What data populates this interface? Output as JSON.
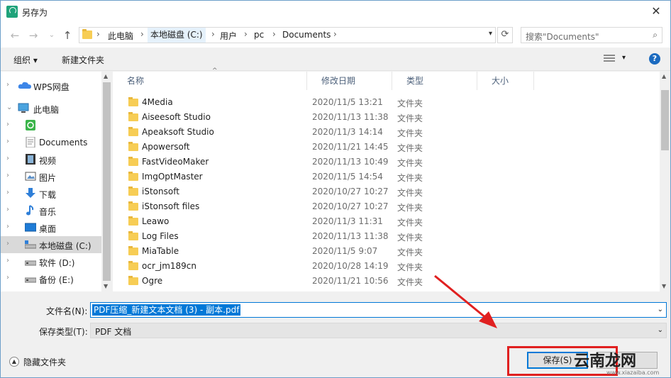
{
  "window": {
    "title": "另存为",
    "close_glyph": "✕",
    "app_icon_label": "PDF"
  },
  "address": {
    "crumbs": [
      "此电脑",
      "本地磁盘 (C:)",
      "用户",
      "pc",
      "Documents"
    ],
    "separator": "›",
    "search_placeholder": "搜索\"Documents\""
  },
  "toolbar": {
    "organize": "组织 ▾",
    "new_folder": "新建文件夹"
  },
  "nav": {
    "items": [
      {
        "label": "WPS网盘",
        "icon": "cloud-icon"
      },
      {
        "label": "此电脑",
        "icon": "computer-icon"
      },
      {
        "label": "",
        "icon": "wps-app-icon"
      },
      {
        "label": "Documents",
        "icon": "documents-icon"
      },
      {
        "label": "视频",
        "icon": "video-icon"
      },
      {
        "label": "图片",
        "icon": "pictures-icon"
      },
      {
        "label": "下载",
        "icon": "download-icon"
      },
      {
        "label": "音乐",
        "icon": "music-icon"
      },
      {
        "label": "桌面",
        "icon": "desktop-icon"
      },
      {
        "label": "本地磁盘 (C:)",
        "icon": "drive-icon"
      },
      {
        "label": "软件 (D:)",
        "icon": "drive-icon"
      },
      {
        "label": "备份 (E:)",
        "icon": "drive-icon"
      }
    ]
  },
  "columns": {
    "name": "名称",
    "date": "修改日期",
    "type": "类型",
    "size": "大小"
  },
  "files": [
    {
      "name": "4Media",
      "date": "2020/11/5 13:21",
      "type": "文件夹"
    },
    {
      "name": "Aiseesoft Studio",
      "date": "2020/11/13 11:38",
      "type": "文件夹"
    },
    {
      "name": "Apeaksoft Studio",
      "date": "2020/11/3 14:14",
      "type": "文件夹"
    },
    {
      "name": "Apowersoft",
      "date": "2020/11/21 14:45",
      "type": "文件夹"
    },
    {
      "name": "FastVideoMaker",
      "date": "2020/11/13 10:49",
      "type": "文件夹"
    },
    {
      "name": "ImgOptMaster",
      "date": "2020/11/5 14:54",
      "type": "文件夹"
    },
    {
      "name": "iStonsoft",
      "date": "2020/10/27 10:27",
      "type": "文件夹"
    },
    {
      "name": "iStonsoft files",
      "date": "2020/10/27 10:27",
      "type": "文件夹"
    },
    {
      "name": "Leawo",
      "date": "2020/11/3 11:31",
      "type": "文件夹"
    },
    {
      "name": "Log Files",
      "date": "2020/11/13 11:38",
      "type": "文件夹"
    },
    {
      "name": "MiaTable",
      "date": "2020/11/5 9:07",
      "type": "文件夹"
    },
    {
      "name": "ocr_jm189cn",
      "date": "2020/10/28 14:19",
      "type": "文件夹"
    },
    {
      "name": "Ogre",
      "date": "2020/11/21 10:56",
      "type": "文件夹"
    }
  ],
  "form": {
    "filename_label": "文件名(N):",
    "filename_value": "PDF压缩_新建文本文档 (3) - 副本.pdf",
    "filetype_label": "保存类型(T):",
    "filetype_value": "PDF 文档",
    "hide_folders": "隐藏文件夹",
    "save": "保存(S)"
  },
  "watermark": {
    "text": "云南龙网",
    "sub": "www.xiazaiba.com"
  },
  "colors": {
    "accent": "#0078d7",
    "annotation": "#e02020",
    "folder": "#f7cd55"
  }
}
